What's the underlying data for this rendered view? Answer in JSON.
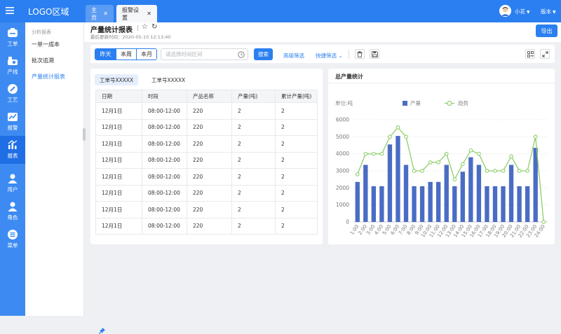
{
  "topbar": {
    "logo": "LOGO区域",
    "user": "小花",
    "version": "版本"
  },
  "tabs": [
    {
      "label": "主页"
    },
    {
      "label": "报警设置"
    }
  ],
  "iconnav": [
    {
      "label": "工单",
      "icon": "workorder-icon"
    },
    {
      "label": "产线",
      "icon": "production-line-icon"
    },
    {
      "label": "工艺",
      "icon": "process-icon"
    },
    {
      "label": "报警",
      "icon": "alarm-icon"
    },
    {
      "label": "报表",
      "icon": "report-icon"
    },
    {
      "label": "用户",
      "icon": "user-icon"
    },
    {
      "label": "角色",
      "icon": "role-icon"
    },
    {
      "label": "菜单",
      "icon": "menu-icon"
    }
  ],
  "subnav": {
    "heading": "分析报表",
    "items": [
      "一单一成本",
      "批次追溯",
      "产量统计报表"
    ]
  },
  "page": {
    "title": "产量统计报表",
    "updated": "最后更新时间：2020-05-10 12:13:40",
    "export_label": "导出"
  },
  "toolbar": {
    "range_buttons": [
      "昨天",
      "本周",
      "本月"
    ],
    "time_placeholder": "请选择时间区间",
    "search_label": "搜索",
    "advanced_filter": "高级筛选",
    "quick_filter": "快捷筛选"
  },
  "table": {
    "tabs": [
      "工单号XXXXX",
      "工单号XXXXX"
    ],
    "columns": [
      "日期",
      "时段",
      "产品名称",
      "产量(吨)",
      "累计产量(吨)"
    ],
    "rows": [
      [
        "12月1日",
        "08:00-12:00",
        "220",
        "2",
        "2"
      ],
      [
        "12月1日",
        "08:00-12:00",
        "220",
        "2",
        "2"
      ],
      [
        "12月1日",
        "08:00-12:00",
        "220",
        "2",
        "2"
      ],
      [
        "12月1日",
        "08:00-12:00",
        "220",
        "2",
        "2"
      ],
      [
        "12月1日",
        "08:00-12:00",
        "220",
        "2",
        "2"
      ],
      [
        "12月1日",
        "08:00-12:00",
        "220",
        "2",
        "2"
      ],
      [
        "12月1日",
        "08:00-12:00",
        "220",
        "2",
        "2"
      ],
      [
        "12月1日",
        "08:00-12:00",
        "220",
        "2",
        "2"
      ]
    ]
  },
  "chart_data": {
    "type": "bar",
    "title": "总产量统计",
    "unit_label": "单位:吨",
    "categories": [
      "1:00",
      "2:00",
      "3:00",
      "4:00",
      "5:00",
      "6:00",
      "7:00",
      "8:00",
      "9:00",
      "10:00",
      "11:00",
      "12:00",
      "13:00",
      "14:00",
      "15:00",
      "16:00",
      "17:00",
      "18:00",
      "19:00",
      "20:00",
      "21:00",
      "22:00",
      "23:00",
      "24:00"
    ],
    "series": [
      {
        "name": "产量",
        "type": "bar",
        "color": "#4a6cc4",
        "values": [
          2350,
          3350,
          2100,
          2100,
          4550,
          5050,
          3350,
          2100,
          2100,
          2350,
          2350,
          3350,
          2100,
          2950,
          3800,
          3350,
          2100,
          2100,
          2100,
          3350,
          2100,
          2100,
          4350,
          0
        ]
      },
      {
        "name": "趋势",
        "type": "line",
        "color": "#8fce6c",
        "values": [
          2800,
          4000,
          4000,
          4000,
          5000,
          5550,
          5000,
          3000,
          3000,
          3500,
          3500,
          4000,
          2500,
          3400,
          4200,
          4000,
          3000,
          3000,
          3000,
          3850,
          3000,
          3000,
          5000,
          0
        ]
      }
    ],
    "ylim": [
      0,
      6000
    ],
    "yticks": [
      0,
      1000,
      2000,
      3000,
      4000,
      5000,
      6000
    ],
    "legend": "top-left",
    "grid": true
  }
}
